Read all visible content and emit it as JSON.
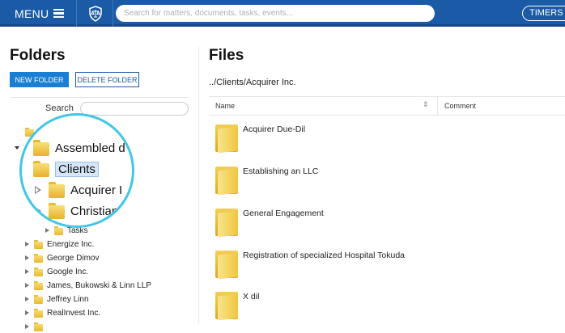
{
  "topbar": {
    "menu_label": "MENU",
    "search_placeholder": "Search for matters, documents, tasks, events...",
    "timers_label": "TIMERS",
    "logo_icon": "shield-scales-icon"
  },
  "folders_panel": {
    "title": "Folders",
    "new_folder_label": "NEW FOLDER",
    "delete_folder_label": "DELETE FOLDER",
    "search_label": "Search",
    "magnified_items": [
      {
        "label": "Assembled d"
      },
      {
        "label": "Clients",
        "selected": true
      },
      {
        "label": "Acquirer I"
      },
      {
        "label": "Christian"
      }
    ],
    "tree_items": [
      {
        "label": "Tasks",
        "level": 2
      },
      {
        "label": "Energize Inc.",
        "level": 1
      },
      {
        "label": "George Dimov",
        "level": 1
      },
      {
        "label": "Google Inc.",
        "level": 1
      },
      {
        "label": "James, Bukowski & Linn LLP",
        "level": 1
      },
      {
        "label": "Jeffrey Linn",
        "level": 1
      },
      {
        "label": "RealInvest Inc.",
        "level": 1
      }
    ]
  },
  "files_panel": {
    "title": "Files",
    "breadcrumb": "../Clients/Acquirer Inc.",
    "columns": {
      "name": "Name",
      "comment": "Comment"
    },
    "files": [
      {
        "name": "Acquirer Due-Dil"
      },
      {
        "name": "Establishing an LLC"
      },
      {
        "name": "General Engagement"
      },
      {
        "name": "Registration of specialized Hospital Tokuda"
      },
      {
        "name": "X dil"
      }
    ]
  },
  "colors": {
    "topbar": "#1a5aa6",
    "accent_button": "#1a7fd4",
    "magnifier_ring": "#41c6e8",
    "folder": "#e8b931"
  }
}
